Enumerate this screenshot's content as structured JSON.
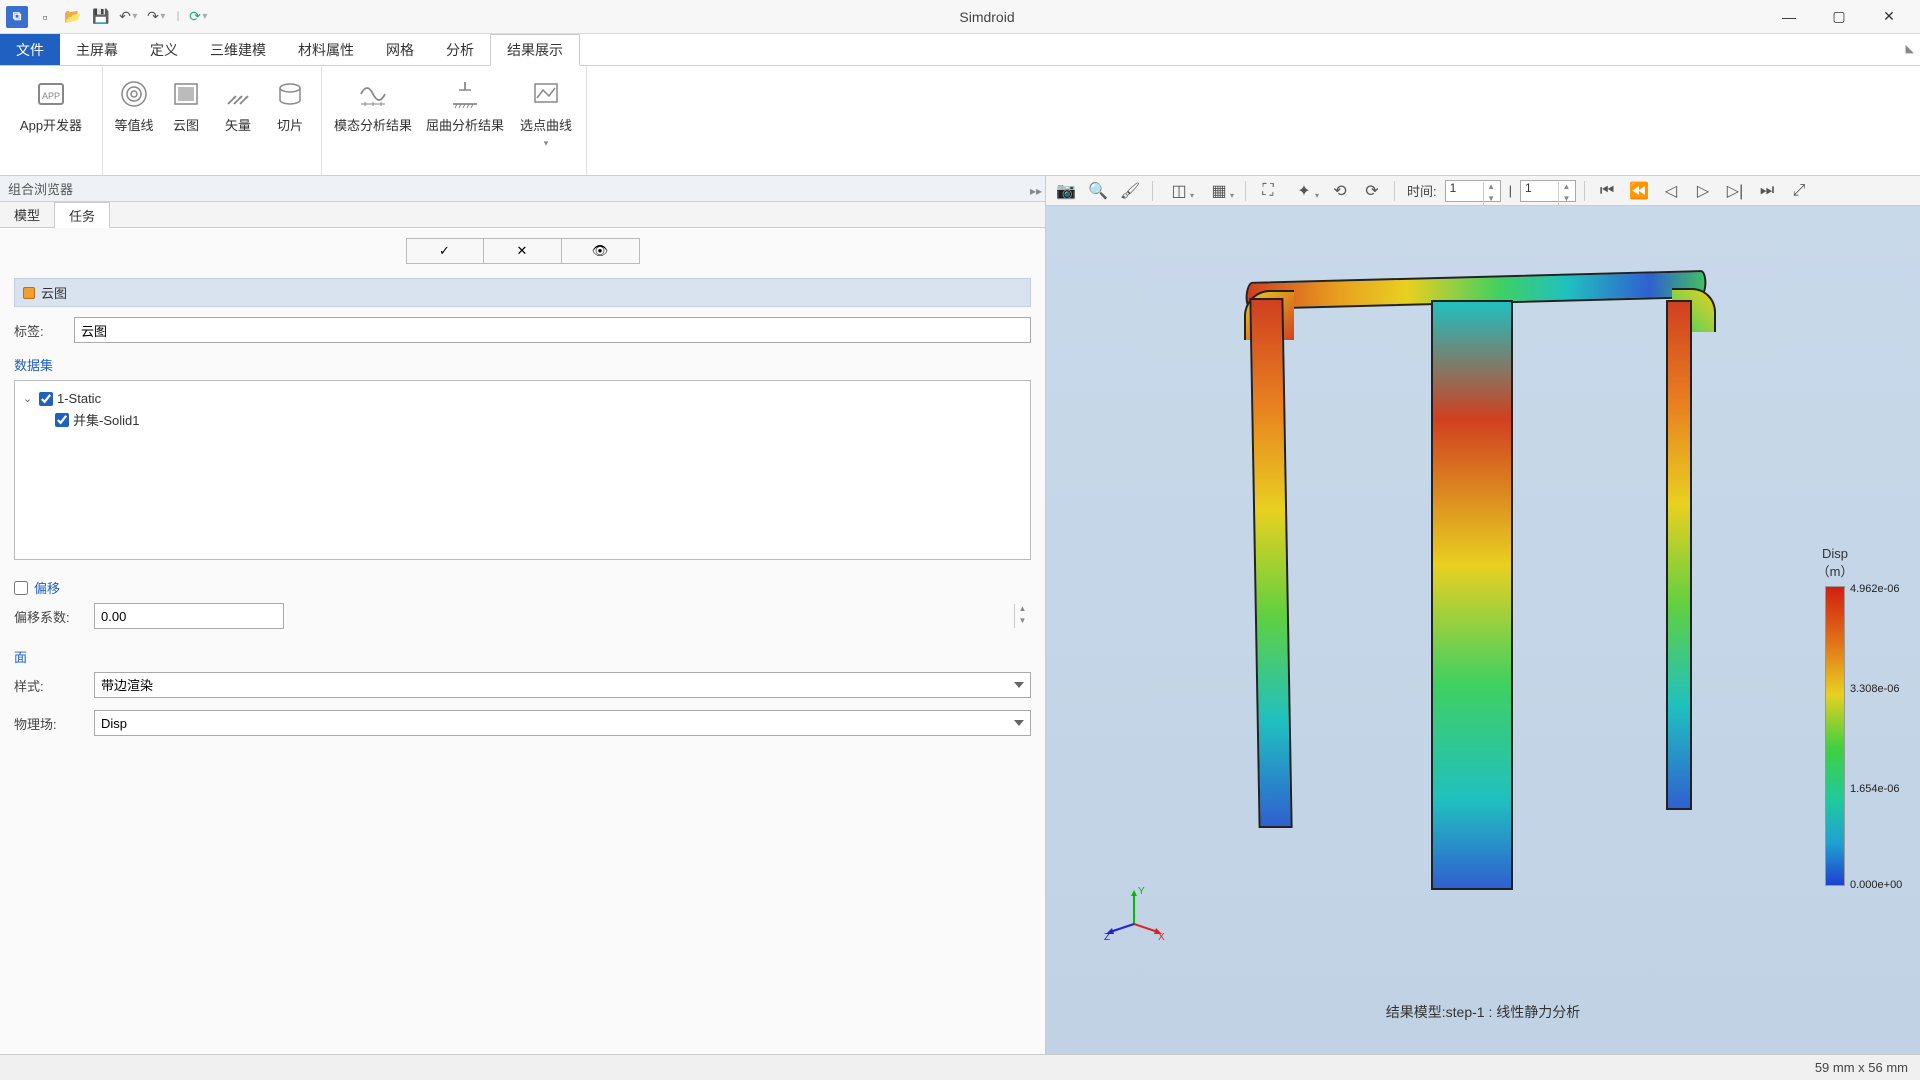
{
  "app": {
    "title": "Simdroid"
  },
  "qat": {
    "undo_dd": "▾",
    "redo_dd": "▾",
    "refresh_dd": "▾"
  },
  "menu": {
    "file": "文件",
    "items": [
      "主屏幕",
      "定义",
      "三维建模",
      "材料属性",
      "网格",
      "分析",
      "结果展示"
    ],
    "active_index": 6
  },
  "ribbon": {
    "groups": [
      {
        "items": [
          {
            "id": "app-dev",
            "label": "App开发器"
          }
        ]
      },
      {
        "items": [
          {
            "id": "contour-line",
            "label": "等值线"
          },
          {
            "id": "cloud",
            "label": "云图"
          },
          {
            "id": "vector",
            "label": "矢量"
          },
          {
            "id": "slice",
            "label": "切片"
          }
        ]
      },
      {
        "items": [
          {
            "id": "modal-result",
            "label": "模态分析结果"
          },
          {
            "id": "buckling-result",
            "label": "屈曲分析结果"
          },
          {
            "id": "pick-curve",
            "label": "选点曲线",
            "dd": true
          }
        ]
      }
    ]
  },
  "panel": {
    "browser_title": "组合浏览器",
    "tabs": [
      "模型",
      "任务"
    ],
    "active_tab": 1,
    "section_title": "云图",
    "label_field": {
      "label": "标签:",
      "value": "云图"
    },
    "dataset": {
      "title": "数据集",
      "tree": [
        {
          "level": 0,
          "checked": true,
          "expanded": true,
          "label": "1-Static"
        },
        {
          "level": 1,
          "checked": true,
          "label": "并集-Solid1"
        }
      ]
    },
    "offset": {
      "checked": false,
      "title": "偏移",
      "coef_label": "偏移系数:",
      "coef_value": "0.00"
    },
    "surface": {
      "title": "面",
      "style_label": "样式:",
      "style_value": "带边渲染",
      "field_label": "物理场:",
      "field_value": "Disp"
    }
  },
  "vp_toolbar": {
    "time_label": "时间:",
    "time_frame": "1",
    "time_step": "1"
  },
  "viewport": {
    "caption": "结果模型:step-1 : 线性静力分析",
    "triad": {
      "x": "X",
      "y": "Y",
      "z": "Z"
    },
    "legend": {
      "title1": "Disp",
      "title2": "（m）",
      "ticks": [
        "4.962e-06",
        "3.308e-06",
        "1.654e-06",
        "0.000e+00"
      ]
    }
  },
  "status": {
    "text": "59 mm x 56 mm"
  }
}
